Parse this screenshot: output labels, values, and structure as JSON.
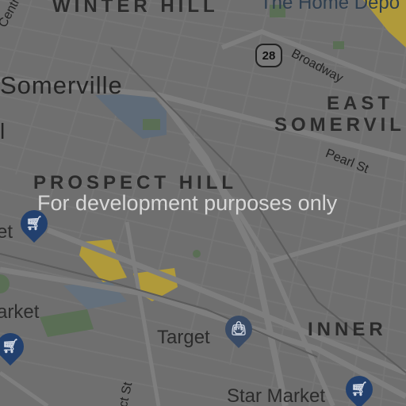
{
  "map": {
    "watermark": "For development purposes only",
    "areas": {
      "winter_hill": "WINTER HILL",
      "east_somerville_1": "EAST",
      "east_somerville_2": "SOMERVIL",
      "prospect_hill": "PROSPECT HILL",
      "inner": "INNER"
    },
    "cities": {
      "somerville": "Somerville"
    },
    "streets": {
      "central": "Central St",
      "broadway": "Broadway",
      "pearl": "Pearl St",
      "bottom_st": "ct St",
      "left_l": "l"
    },
    "route_shield": "28",
    "pois": {
      "home_depot": "The Home Depo",
      "target": "Target",
      "star_market": "Star Market",
      "market_left": "arket",
      "et_left": "et"
    },
    "colors": {
      "background": "#6f6f6f",
      "road": "#7c7c7c",
      "water": "#5f6b78",
      "park": "#5a6e55",
      "highlight": "#b09a3a",
      "pin_shopping": "#22406e",
      "pin_target": "#394b66"
    },
    "icons": {
      "shopping_pin": "shopping-cart-icon",
      "target_pin": "shopping-bag-icon"
    }
  }
}
